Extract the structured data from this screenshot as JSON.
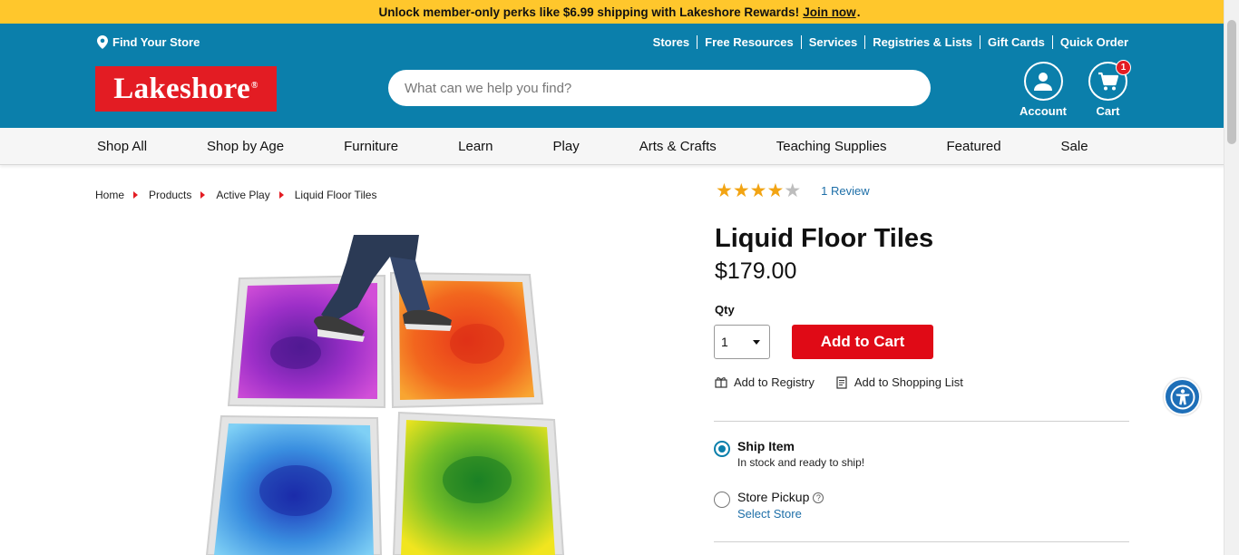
{
  "promo": {
    "text": "Unlock member-only perks like $6.99 shipping with Lakeshore Rewards!",
    "link": "Join now",
    "end": "."
  },
  "header": {
    "find_store": "Find Your Store",
    "top_links": [
      "Stores",
      "Free Resources",
      "Services",
      "Registries & Lists",
      "Gift Cards",
      "Quick Order"
    ],
    "logo": "Lakeshore",
    "logo_mark": "®",
    "search_placeholder": "What can we help you find?",
    "account_label": "Account",
    "cart_label": "Cart",
    "cart_count": "1"
  },
  "nav": [
    "Shop All",
    "Shop by Age",
    "Furniture",
    "Learn",
    "Play",
    "Arts & Crafts",
    "Teaching Supplies",
    "Featured",
    "Sale"
  ],
  "breadcrumb": [
    "Home",
    "Products",
    "Active Play",
    "Liquid Floor Tiles"
  ],
  "product": {
    "rating": 4,
    "rating_max": 5,
    "reviews": "1 Review",
    "title": "Liquid Floor Tiles",
    "price": "$179.00",
    "qty_label": "Qty",
    "qty_value": "1",
    "add_to_cart": "Add to Cart",
    "add_to_registry": "Add to Registry",
    "add_to_list": "Add to Shopping List"
  },
  "fulfillment": {
    "ship_title": "Ship Item",
    "ship_sub": "In stock and ready to ship!",
    "pickup_title": "Store Pickup",
    "pickup_help": "?",
    "pickup_link": "Select Store"
  },
  "colors": {
    "promo": "#ffc72c",
    "header": "#0b7fab",
    "brand_red": "#e31c23",
    "star": "#f2a413",
    "link": "#1e6fa8"
  }
}
